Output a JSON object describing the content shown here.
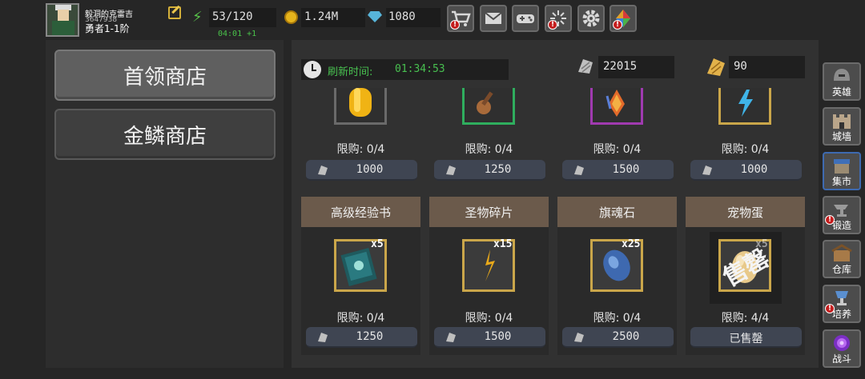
{
  "player": {
    "name": "毅洞的克雷吉",
    "id": "3647938",
    "rank": "勇者1-1阶"
  },
  "resources": {
    "energy": "53/120",
    "energy_timer": "04:01 +1",
    "gold": "1.24M",
    "gems": "1080"
  },
  "top_buttons": [
    {
      "name": "shop-cart",
      "icon": "cart-icon",
      "badge": "!"
    },
    {
      "name": "mail",
      "icon": "mail-icon",
      "badge": ""
    },
    {
      "name": "gamepad",
      "icon": "gamepad-icon",
      "badge": ""
    },
    {
      "name": "event",
      "icon": "firework-icon",
      "badge": "!"
    },
    {
      "name": "settings",
      "icon": "gear-icon",
      "badge": ""
    },
    {
      "name": "color",
      "icon": "colorful-icon",
      "badge": "!"
    }
  ],
  "shop_tabs": [
    {
      "label": "首领商店"
    },
    {
      "label": "金鳞商店"
    }
  ],
  "refresh": {
    "label": "刷新时间:",
    "time": "01:34:53"
  },
  "currency": {
    "scales": "22015",
    "gold_scales": "90"
  },
  "items_row1": [
    {
      "limit": "限购: 0/4",
      "price": "1000",
      "icon": "gold-token-icon"
    },
    {
      "limit": "限购: 0/4",
      "price": "1250",
      "icon": "guitar-icon"
    },
    {
      "limit": "限购: 0/4",
      "price": "1500",
      "icon": "flame-crystal-icon"
    },
    {
      "limit": "限购: 0/4",
      "price": "1000",
      "icon": "lightning-icon"
    }
  ],
  "items_row2": [
    {
      "name": "高级经验书",
      "qty": "x5",
      "limit": "限购: 0/4",
      "price": "1250",
      "icon": "exp-book-icon",
      "sold": false
    },
    {
      "name": "圣物碎片",
      "qty": "x15",
      "limit": "限购: 0/4",
      "price": "1500",
      "icon": "relic-shard-icon",
      "sold": false
    },
    {
      "name": "旗魂石",
      "qty": "x25",
      "limit": "限购: 0/4",
      "price": "2500",
      "icon": "soul-stone-icon",
      "sold": false
    },
    {
      "name": "宠物蛋",
      "qty": "x5",
      "limit": "限购: 4/4",
      "price": "已售罄",
      "icon": "pet-egg-icon",
      "sold": true,
      "stamp": "售罄"
    }
  ],
  "sidebar": [
    {
      "label": "英雄",
      "icon": "helmet-icon",
      "badge": ""
    },
    {
      "label": "城墙",
      "icon": "wall-icon",
      "badge": ""
    },
    {
      "label": "集市",
      "icon": "market-icon",
      "badge": ""
    },
    {
      "label": "锻造",
      "icon": "anvil-icon",
      "badge": "!"
    },
    {
      "label": "仓库",
      "icon": "warehouse-icon",
      "badge": ""
    },
    {
      "label": "培养",
      "icon": "chalice-icon",
      "badge": "!"
    },
    {
      "label": "战斗",
      "icon": "portal-icon",
      "badge": ""
    }
  ],
  "colors": {
    "accent_green": "#48c050",
    "badge_red": "#c41d1d",
    "frame_gold": "#caa64a",
    "namebar_brown": "#6b5a4b"
  }
}
